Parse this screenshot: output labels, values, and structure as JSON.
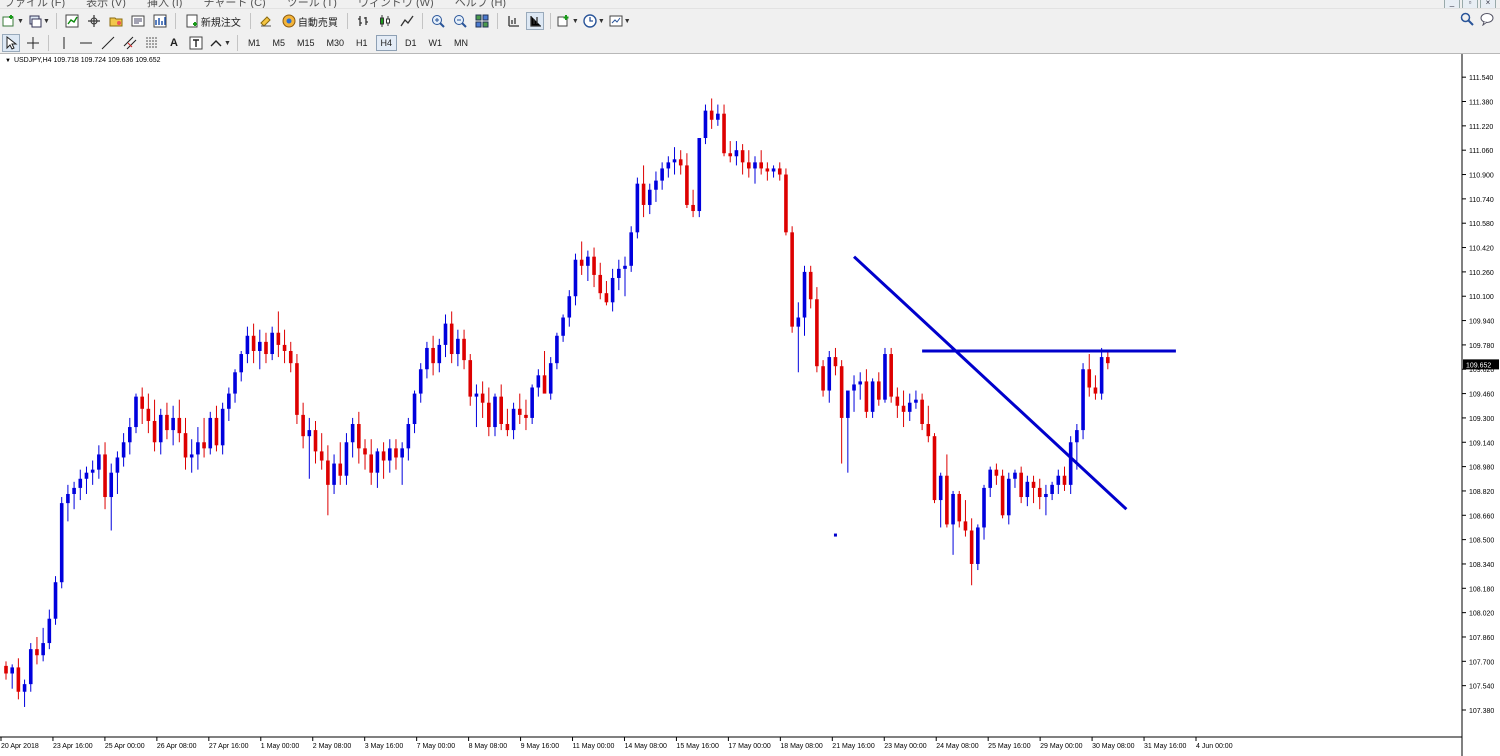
{
  "menu": {
    "items": [
      "ファイル (F)",
      "表示 (V)",
      "挿入 (I)",
      "チャート (C)",
      "ツール (T)",
      "ウィンドウ (W)",
      "ヘルプ (H)"
    ]
  },
  "toolbar": {
    "new_order_label": "新規注文",
    "auto_trade_label": "自動売買",
    "timeframes": [
      "M1",
      "M5",
      "M15",
      "M30",
      "H1",
      "H4",
      "D1",
      "W1",
      "MN"
    ],
    "active_timeframe": "H4"
  },
  "chart": {
    "symbol_line": "USDJPY,H4  109.718 109.724 109.636 109.652",
    "current_price_label": "109.652",
    "colors": {
      "bull": "#0000dd",
      "bear": "#dd0000",
      "lines": "#0000cc",
      "price_tag_bg": "#000000"
    }
  },
  "chart_data": {
    "type": "candlestick",
    "symbol": "USDJPY",
    "timeframe": "H4",
    "ylim": [
      107.38,
      111.62
    ],
    "y_ticks": [
      "111.540",
      "111.380",
      "111.220",
      "111.060",
      "110.900",
      "110.740",
      "110.580",
      "110.420",
      "110.260",
      "110.100",
      "109.940",
      "109.780",
      "109.620",
      "109.460",
      "109.300",
      "109.140",
      "108.980",
      "108.820",
      "108.660",
      "108.500",
      "108.340",
      "108.180",
      "108.020",
      "107.860",
      "107.700",
      "107.540",
      "107.380"
    ],
    "x_ticks": [
      "20 Apr 2018",
      "23 Apr 16:00",
      "25 Apr 00:00",
      "26 Apr 08:00",
      "27 Apr 16:00",
      "1 May 00:00",
      "2 May 08:00",
      "3 May 16:00",
      "7 May 00:00",
      "8 May 08:00",
      "9 May 16:00",
      "11 May 00:00",
      "14 May 08:00",
      "15 May 16:00",
      "17 May 00:00",
      "18 May 08:00",
      "21 May 16:00",
      "23 May 00:00",
      "24 May 08:00",
      "25 May 16:00",
      "29 May 00:00",
      "30 May 08:00",
      "31 May 16:00",
      "4 Jun 00:00"
    ],
    "ohlc": [
      [
        107.67,
        107.7,
        107.58,
        107.62
      ],
      [
        107.62,
        107.68,
        107.52,
        107.66
      ],
      [
        107.66,
        107.72,
        107.45,
        107.5
      ],
      [
        107.5,
        107.58,
        107.4,
        107.55
      ],
      [
        107.55,
        107.82,
        107.5,
        107.78
      ],
      [
        107.78,
        107.86,
        107.68,
        107.74
      ],
      [
        107.74,
        107.92,
        107.7,
        107.82
      ],
      [
        107.82,
        108.04,
        107.78,
        107.98
      ],
      [
        107.98,
        108.26,
        107.94,
        108.22
      ],
      [
        108.22,
        108.78,
        108.18,
        108.74
      ],
      [
        108.74,
        108.86,
        108.62,
        108.8
      ],
      [
        108.8,
        108.88,
        108.7,
        108.84
      ],
      [
        108.84,
        108.96,
        108.76,
        108.9
      ],
      [
        108.9,
        108.98,
        108.8,
        108.94
      ],
      [
        108.94,
        109.02,
        108.86,
        108.96
      ],
      [
        108.96,
        109.12,
        108.9,
        109.06
      ],
      [
        109.06,
        109.14,
        108.7,
        108.78
      ],
      [
        108.78,
        109.0,
        108.56,
        108.94
      ],
      [
        108.94,
        109.08,
        108.8,
        109.04
      ],
      [
        109.04,
        109.2,
        108.98,
        109.14
      ],
      [
        109.14,
        109.3,
        109.06,
        109.24
      ],
      [
        109.24,
        109.46,
        109.2,
        109.44
      ],
      [
        109.44,
        109.5,
        109.26,
        109.36
      ],
      [
        109.36,
        109.46,
        109.2,
        109.28
      ],
      [
        109.28,
        109.42,
        109.08,
        109.14
      ],
      [
        109.14,
        109.36,
        109.06,
        109.32
      ],
      [
        109.32,
        109.4,
        109.16,
        109.22
      ],
      [
        109.22,
        109.38,
        109.12,
        109.3
      ],
      [
        109.3,
        109.42,
        109.14,
        109.2
      ],
      [
        109.2,
        109.3,
        108.96,
        109.04
      ],
      [
        109.04,
        109.16,
        108.94,
        109.06
      ],
      [
        109.06,
        109.24,
        108.96,
        109.14
      ],
      [
        109.14,
        109.3,
        109.04,
        109.1
      ],
      [
        109.1,
        109.34,
        109.06,
        109.3
      ],
      [
        109.3,
        109.38,
        109.08,
        109.12
      ],
      [
        109.12,
        109.4,
        109.06,
        109.36
      ],
      [
        109.36,
        109.5,
        109.28,
        109.46
      ],
      [
        109.46,
        109.62,
        109.4,
        109.6
      ],
      [
        109.6,
        109.74,
        109.54,
        109.72
      ],
      [
        109.72,
        109.9,
        109.66,
        109.84
      ],
      [
        109.84,
        109.92,
        109.66,
        109.74
      ],
      [
        109.74,
        109.88,
        109.62,
        109.8
      ],
      [
        109.8,
        109.86,
        109.66,
        109.72
      ],
      [
        109.72,
        109.9,
        109.68,
        109.86
      ],
      [
        109.86,
        110.0,
        109.7,
        109.78
      ],
      [
        109.78,
        109.88,
        109.66,
        109.74
      ],
      [
        109.74,
        109.8,
        109.6,
        109.66
      ],
      [
        109.66,
        109.72,
        109.26,
        109.32
      ],
      [
        109.32,
        109.4,
        109.1,
        109.18
      ],
      [
        109.18,
        109.3,
        108.9,
        109.22
      ],
      [
        109.22,
        109.28,
        109.0,
        109.08
      ],
      [
        109.08,
        109.2,
        108.96,
        109.02
      ],
      [
        109.02,
        109.12,
        108.66,
        108.86
      ],
      [
        108.86,
        109.06,
        108.8,
        109.0
      ],
      [
        109.0,
        109.14,
        108.86,
        108.92
      ],
      [
        108.92,
        109.2,
        108.86,
        109.14
      ],
      [
        109.14,
        109.3,
        109.04,
        109.26
      ],
      [
        109.26,
        109.34,
        109.0,
        109.1
      ],
      [
        109.1,
        109.16,
        108.96,
        109.06
      ],
      [
        109.06,
        109.16,
        108.86,
        108.94
      ],
      [
        108.94,
        109.1,
        108.84,
        109.08
      ],
      [
        109.08,
        109.14,
        108.9,
        109.02
      ],
      [
        109.02,
        109.16,
        108.94,
        109.1
      ],
      [
        109.1,
        109.16,
        108.96,
        109.04
      ],
      [
        109.04,
        109.14,
        108.86,
        109.1
      ],
      [
        109.1,
        109.3,
        109.02,
        109.26
      ],
      [
        109.26,
        109.48,
        109.2,
        109.46
      ],
      [
        109.46,
        109.66,
        109.4,
        109.62
      ],
      [
        109.62,
        109.8,
        109.56,
        109.76
      ],
      [
        109.76,
        109.84,
        109.58,
        109.66
      ],
      [
        109.66,
        109.82,
        109.6,
        109.78
      ],
      [
        109.78,
        109.98,
        109.7,
        109.92
      ],
      [
        109.92,
        110.0,
        109.66,
        109.72
      ],
      [
        109.72,
        109.88,
        109.64,
        109.82
      ],
      [
        109.82,
        109.88,
        109.62,
        109.68
      ],
      [
        109.68,
        109.72,
        109.38,
        109.44
      ],
      [
        109.44,
        109.52,
        109.24,
        109.46
      ],
      [
        109.46,
        109.54,
        109.3,
        109.4
      ],
      [
        109.4,
        109.5,
        109.18,
        109.24
      ],
      [
        109.24,
        109.46,
        109.18,
        109.44
      ],
      [
        109.44,
        109.52,
        109.22,
        109.26
      ],
      [
        109.26,
        109.36,
        109.18,
        109.22
      ],
      [
        109.22,
        109.4,
        109.16,
        109.36
      ],
      [
        109.36,
        109.46,
        109.26,
        109.32
      ],
      [
        109.32,
        109.42,
        109.22,
        109.3
      ],
      [
        109.3,
        109.52,
        109.26,
        109.5
      ],
      [
        109.5,
        109.62,
        109.44,
        109.58
      ],
      [
        109.58,
        109.74,
        109.5,
        109.46
      ],
      [
        109.46,
        109.7,
        109.42,
        109.66
      ],
      [
        109.66,
        109.86,
        109.62,
        109.84
      ],
      [
        109.84,
        109.98,
        109.8,
        109.96
      ],
      [
        109.96,
        110.14,
        109.9,
        110.1
      ],
      [
        110.1,
        110.38,
        110.04,
        110.34
      ],
      [
        110.34,
        110.46,
        110.24,
        110.3
      ],
      [
        110.3,
        110.4,
        110.2,
        110.36
      ],
      [
        110.36,
        110.42,
        110.16,
        110.24
      ],
      [
        110.24,
        110.32,
        110.08,
        110.12
      ],
      [
        110.12,
        110.2,
        110.04,
        110.06
      ],
      [
        110.06,
        110.28,
        110.0,
        110.22
      ],
      [
        110.22,
        110.34,
        110.14,
        110.28
      ],
      [
        110.28,
        110.36,
        110.1,
        110.3
      ],
      [
        110.3,
        110.56,
        110.26,
        110.52
      ],
      [
        110.52,
        110.88,
        110.48,
        110.84
      ],
      [
        110.84,
        110.96,
        110.62,
        110.7
      ],
      [
        110.7,
        110.84,
        110.64,
        110.8
      ],
      [
        110.8,
        110.92,
        110.72,
        110.86
      ],
      [
        110.86,
        110.98,
        110.8,
        110.94
      ],
      [
        110.94,
        111.02,
        110.88,
        110.98
      ],
      [
        110.98,
        111.08,
        110.9,
        111.0
      ],
      [
        111.0,
        111.06,
        110.9,
        110.96
      ],
      [
        110.96,
        111.04,
        110.68,
        110.7
      ],
      [
        110.7,
        110.8,
        110.62,
        110.66
      ],
      [
        110.66,
        110.9,
        110.62,
        111.14
      ],
      [
        111.14,
        111.36,
        111.1,
        111.32
      ],
      [
        111.32,
        111.4,
        111.2,
        111.26
      ],
      [
        111.26,
        111.36,
        111.22,
        111.3
      ],
      [
        111.3,
        111.36,
        111.02,
        111.04
      ],
      [
        111.04,
        111.12,
        110.98,
        111.02
      ],
      [
        111.02,
        111.12,
        110.96,
        111.06
      ],
      [
        111.06,
        111.1,
        110.9,
        110.98
      ],
      [
        110.98,
        111.06,
        110.88,
        110.94
      ],
      [
        110.94,
        111.02,
        110.84,
        110.98
      ],
      [
        110.98,
        111.06,
        110.9,
        110.94
      ],
      [
        110.94,
        110.98,
        110.86,
        110.92
      ],
      [
        110.92,
        110.96,
        110.88,
        110.94
      ],
      [
        110.94,
        110.98,
        110.86,
        110.9
      ],
      [
        110.9,
        110.94,
        110.5,
        110.52
      ],
      [
        110.52,
        110.56,
        109.86,
        109.9
      ],
      [
        109.9,
        110.06,
        109.6,
        109.96
      ],
      [
        109.96,
        110.3,
        109.84,
        110.26
      ],
      [
        110.26,
        110.3,
        110.02,
        110.08
      ],
      [
        110.08,
        110.16,
        109.6,
        109.64
      ],
      [
        109.64,
        109.68,
        109.44,
        109.48
      ],
      [
        109.48,
        109.74,
        109.4,
        109.7
      ],
      [
        109.7,
        109.76,
        109.58,
        109.64
      ],
      [
        109.64,
        109.68,
        109.0,
        109.3
      ],
      [
        109.3,
        109.34,
        108.94,
        109.48
      ],
      [
        109.48,
        109.58,
        109.34,
        109.52
      ],
      [
        109.52,
        109.6,
        109.42,
        109.54
      ],
      [
        109.54,
        109.62,
        109.3,
        109.34
      ],
      [
        109.34,
        109.56,
        109.3,
        109.54
      ],
      [
        109.54,
        109.6,
        109.38,
        109.42
      ],
      [
        109.42,
        109.76,
        109.4,
        109.72
      ],
      [
        109.72,
        109.76,
        109.4,
        109.44
      ],
      [
        109.44,
        109.5,
        109.3,
        109.38
      ],
      [
        109.38,
        109.48,
        109.24,
        109.34
      ],
      [
        109.34,
        109.46,
        109.28,
        109.4
      ],
      [
        109.4,
        109.48,
        109.36,
        109.42
      ],
      [
        109.42,
        109.46,
        109.22,
        109.26
      ],
      [
        109.26,
        109.38,
        109.14,
        109.18
      ],
      [
        109.18,
        109.2,
        108.74,
        108.76
      ],
      [
        108.76,
        108.94,
        108.58,
        108.92
      ],
      [
        108.92,
        109.06,
        108.58,
        108.6
      ],
      [
        108.6,
        108.82,
        108.4,
        108.8
      ],
      [
        108.8,
        108.82,
        108.58,
        108.62
      ],
      [
        108.62,
        108.76,
        108.52,
        108.56
      ],
      [
        108.56,
        108.64,
        108.2,
        108.34
      ],
      [
        108.34,
        108.6,
        108.3,
        108.58
      ],
      [
        108.58,
        108.86,
        108.5,
        108.84
      ],
      [
        108.84,
        108.98,
        108.78,
        108.96
      ],
      [
        108.96,
        109.0,
        108.86,
        108.92
      ],
      [
        108.92,
        108.96,
        108.64,
        108.66
      ],
      [
        108.66,
        108.94,
        108.6,
        108.9
      ],
      [
        108.9,
        108.96,
        108.84,
        108.94
      ],
      [
        108.94,
        108.98,
        108.74,
        108.78
      ],
      [
        108.78,
        108.92,
        108.72,
        108.88
      ],
      [
        108.88,
        108.92,
        108.74,
        108.84
      ],
      [
        108.84,
        108.9,
        108.7,
        108.78
      ],
      [
        108.78,
        108.86,
        108.66,
        108.8
      ],
      [
        108.8,
        108.88,
        108.76,
        108.86
      ],
      [
        108.86,
        108.96,
        108.8,
        108.92
      ],
      [
        108.92,
        108.98,
        108.82,
        108.86
      ],
      [
        108.86,
        109.18,
        108.8,
        109.14
      ],
      [
        109.14,
        109.26,
        108.96,
        109.22
      ],
      [
        109.22,
        109.66,
        109.16,
        109.62
      ],
      [
        109.62,
        109.72,
        109.44,
        109.5
      ],
      [
        109.5,
        109.58,
        109.42,
        109.46
      ],
      [
        109.46,
        109.76,
        109.42,
        109.7
      ],
      [
        109.7,
        109.74,
        109.62,
        109.66
      ]
    ],
    "trendlines": [
      {
        "type": "trend",
        "from_index": 137,
        "from_price": 110.36,
        "to_index": 181,
        "to_price": 108.7
      },
      {
        "type": "horizontal",
        "price": 109.74,
        "from_index": 148,
        "to_index": 189
      }
    ],
    "marker": {
      "index": 134,
      "price": 108.53
    },
    "last_price": 109.652
  }
}
